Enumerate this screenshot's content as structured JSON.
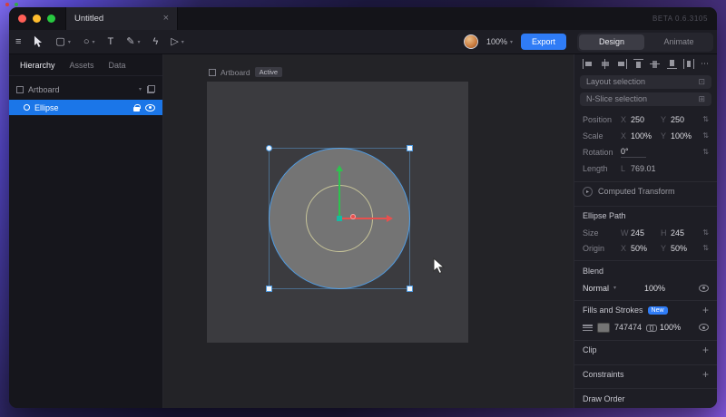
{
  "titlebar": {
    "tab_title": "Untitled",
    "beta_label": "BETA 0.6.3105"
  },
  "toolbar": {
    "zoom_value": "100%",
    "export_label": "Export",
    "design_label": "Design",
    "animate_label": "Animate"
  },
  "left_panel": {
    "tabs": [
      {
        "label": "Hierarchy"
      },
      {
        "label": "Assets"
      },
      {
        "label": "Data"
      }
    ],
    "items": [
      {
        "label": "Artboard"
      },
      {
        "label": "Ellipse"
      }
    ]
  },
  "canvas": {
    "artboard_label": "Artboard",
    "active_badge": "Active"
  },
  "inspector": {
    "layout_selection_label": "Layout selection",
    "nslice_selection_label": "N-Slice selection",
    "position": {
      "label": "Position",
      "x_key": "X",
      "x_value": "250",
      "y_key": "Y",
      "y_value": "250"
    },
    "scale": {
      "label": "Scale",
      "x_key": "X",
      "x_value": "100%",
      "y_key": "Y",
      "y_value": "100%"
    },
    "rotation": {
      "label": "Rotation",
      "value": "0°"
    },
    "length": {
      "label": "Length",
      "key": "L",
      "value": "769.01"
    },
    "computed_transform_label": "Computed Transform",
    "ellipse_path_label": "Ellipse Path",
    "size": {
      "label": "Size",
      "w_key": "W",
      "w_value": "245",
      "h_key": "H",
      "h_value": "245"
    },
    "origin": {
      "label": "Origin",
      "x_key": "X",
      "x_value": "50%",
      "y_key": "Y",
      "y_value": "50%"
    },
    "blend_label": "Blend",
    "blend_mode": "Normal",
    "blend_opacity": "100%",
    "fills_label": "Fills and Strokes",
    "fills_badge": "New",
    "fill_hex": "747474",
    "fill_opacity": "100%",
    "clip_label": "Clip",
    "constraints_label": "Constraints",
    "draw_order_label": "Draw Order"
  },
  "icons": {
    "hamburger": "≡",
    "frame_tool": "▢",
    "ellipse_tool": "○",
    "text_tool": "T",
    "pen_tool": "✎",
    "bones_tool": "ϟ",
    "play_tool": "▷",
    "chevron_down": "▾",
    "more": "⋯",
    "plus": "+",
    "stepper": "⇅",
    "expand": "⊡",
    "nslice": "⊞",
    "collapse": "▸",
    "close": "×"
  },
  "colors": {
    "accent_blue": "#2F7CF6",
    "selection_blue": "#4F9BE2",
    "row_selected": "#1B76E8",
    "fill_gray": "#747474",
    "gizmo_green": "#2EC24E",
    "gizmo_red": "#E8504E",
    "origin_teal": "#17B9A3",
    "guide_yellow": "#D6D2A0",
    "avatar_orange": "#C97B3E"
  }
}
